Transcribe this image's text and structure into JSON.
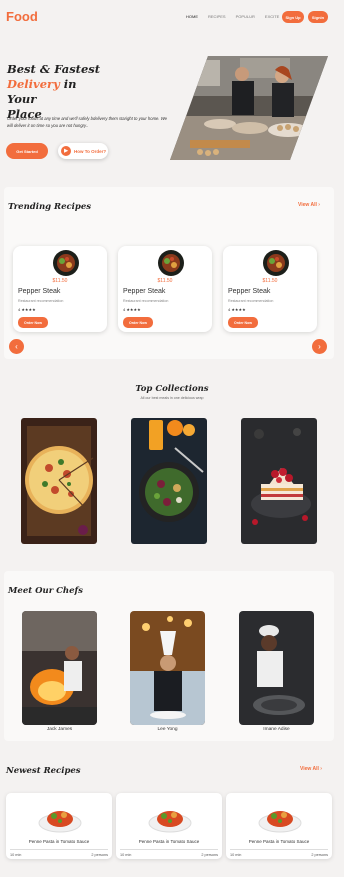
{
  "header": {
    "logo": "Food",
    "menu": [
      "HOME",
      "RECIPES",
      "POPULUR",
      "EXCITE"
    ],
    "signup": "Sign Up",
    "signin": "Signin"
  },
  "hero": {
    "title_line1": "Best & Fastest",
    "title_highlight": "Delivery",
    "title_rest": "in Your",
    "title_line3": "Place",
    "text": "Order your foods at any time and we'll safely bdelivery them staright to your home. We will deliver it on time so you are not hungry..",
    "get_started": "Get Started",
    "how_to_order": "How To Order?"
  },
  "trending": {
    "title": "Trending Recipes",
    "view_all": "View All",
    "cards": [
      {
        "price": "$11.50",
        "name": "Pepper Steak",
        "desc": "Restaurant recommendation",
        "rating": "4 ★★★★",
        "button": "Order Now"
      },
      {
        "price": "$11.50",
        "name": "Pepper Steak",
        "desc": "Restaurant recommendation",
        "rating": "4 ★★★★",
        "button": "Order Now"
      },
      {
        "price": "$11.50",
        "name": "Pepper Steak",
        "desc": "Restaurant recommendation",
        "rating": "4 ★★★★",
        "button": "Order Now"
      }
    ]
  },
  "collections": {
    "title": "Top Collections",
    "subtitle": "All our best meals in one delicious wrap"
  },
  "chefs": {
    "title": "Meet Our Chefs",
    "names": [
      "Jack James",
      "Lee Yong",
      "Imane Adise"
    ]
  },
  "newest": {
    "title": "Newest Recipes",
    "view_all": "View All",
    "cards": [
      {
        "name": "Penne Pasta in Tomato Sauce",
        "time": "10 min",
        "servings": "2 persons"
      },
      {
        "name": "Penne Pasta in Tomato Sauce",
        "time": "10 min",
        "servings": "2 persons"
      },
      {
        "name": "Penne Pasta in Tomato Sauce",
        "time": "10 min",
        "servings": "2 persons"
      }
    ]
  },
  "colors": {
    "accent": "#f26d3d",
    "background": "#f4f2f1"
  }
}
